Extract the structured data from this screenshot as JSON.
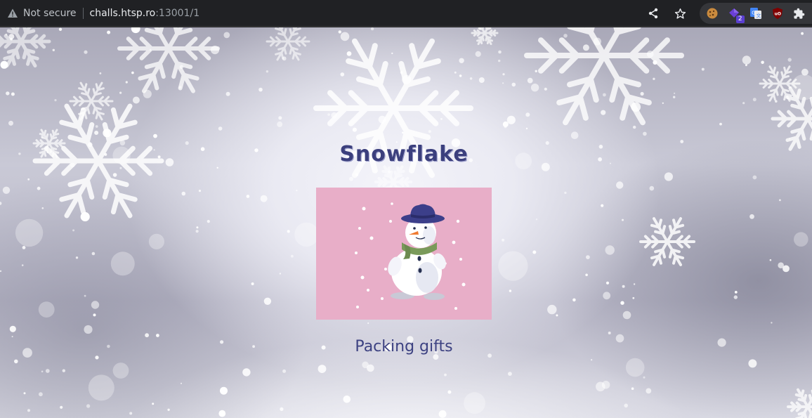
{
  "browser": {
    "security_label": "Not secure",
    "url_host": "challs.htsp.ro",
    "url_port_path": ":13001/1",
    "extension_badge": "2"
  },
  "page": {
    "title": "Snowflake",
    "image_caption": "Packing gifts"
  },
  "icons": {
    "security": "warning-icon",
    "share": "share-icon",
    "bookmark": "star-icon",
    "extensions": [
      "cookie-extension-icon",
      "purple-extension-icon",
      "translate-extension-icon",
      "ublock-extension-icon",
      "puzzle-extensions-icon"
    ]
  },
  "colors": {
    "title": "#3b3f7d",
    "caption": "#3d4282",
    "card_background": "#e8aec8",
    "toolbar": "#202124"
  }
}
